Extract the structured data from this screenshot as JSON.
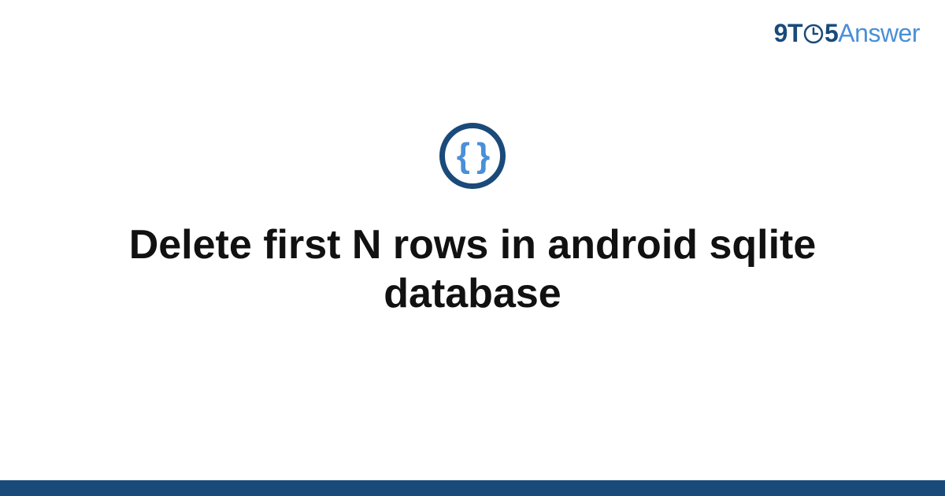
{
  "brand": {
    "part1": "9T",
    "part2": "5",
    "part3": "Answer"
  },
  "icon": {
    "braces": "{ }",
    "name": "code-braces-icon"
  },
  "title": "Delete first N rows in android sqlite database",
  "colors": {
    "primary": "#1a4a7a",
    "accent": "#4a8fd8",
    "text": "#111111",
    "background": "#ffffff"
  }
}
